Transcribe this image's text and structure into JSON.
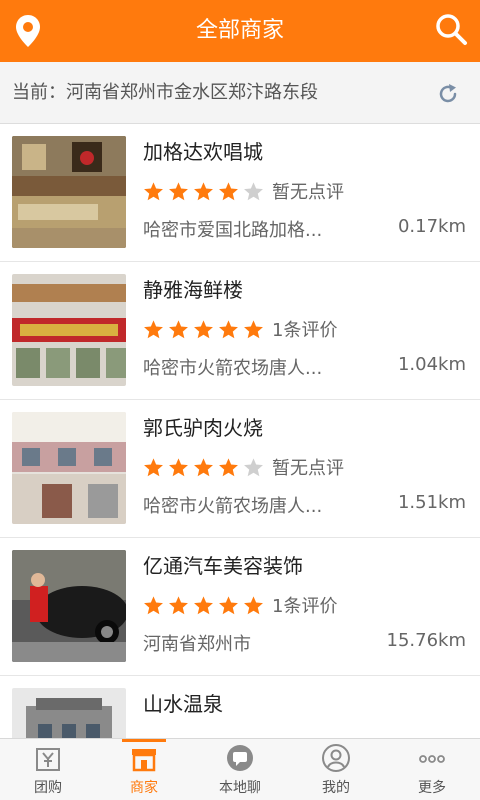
{
  "header": {
    "title": "全部商家"
  },
  "location": {
    "text": "当前：河南省郑州市金水区郑汴路东段"
  },
  "merchants": [
    {
      "name": "加格达欢唱城",
      "rating": 4,
      "reviews": "暂无点评",
      "address": "哈密市爱国北路加格...",
      "distance": "0.17km"
    },
    {
      "name": "静雅海鲜楼",
      "rating": 5,
      "reviews": "1条评价",
      "address": "哈密市火箭农场唐人...",
      "distance": "1.04km"
    },
    {
      "name": "郭氏驴肉火烧",
      "rating": 4,
      "reviews": "暂无点评",
      "address": "哈密市火箭农场唐人...",
      "distance": "1.51km"
    },
    {
      "name": "亿通汽车美容装饰",
      "rating": 5,
      "reviews": "1条评价",
      "address": "河南省郑州市",
      "distance": "15.76km"
    },
    {
      "name": "山水温泉",
      "rating": 0,
      "reviews": "",
      "address": "",
      "distance": ""
    }
  ],
  "tabs": [
    {
      "label": "团购",
      "icon": "group-buy-icon"
    },
    {
      "label": "商家",
      "icon": "shop-icon"
    },
    {
      "label": "本地聊",
      "icon": "chat-icon"
    },
    {
      "label": "我的",
      "icon": "profile-icon"
    },
    {
      "label": "更多",
      "icon": "more-icon"
    }
  ],
  "colors": {
    "accent": "#ff7a0d",
    "star_on": "#ff7a0d",
    "star_off": "#cfcfcf"
  }
}
